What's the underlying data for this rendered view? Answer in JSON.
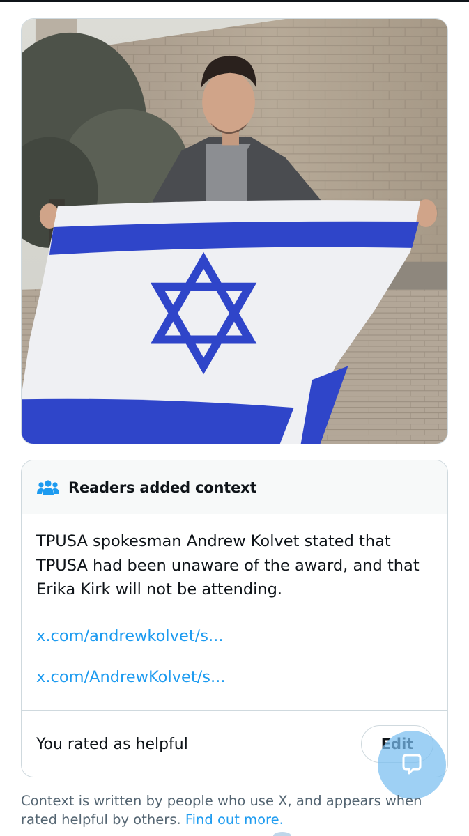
{
  "note": {
    "header_icon": "people-icon",
    "title": "Readers added context",
    "body": "TPUSA spokesman Andrew Kolvet stated that TPUSA had been unaware of the award, and that Erika Kirk will not be attending.",
    "links": [
      "x.com/andrewkolvet/s...",
      "x.com/AndrewKolvet/s..."
    ],
    "rating_text": "You rated as helpful",
    "edit_label": "Edit"
  },
  "fab_icon": "chat-bubble-icon",
  "disclaimer": {
    "text": "Context is written by people who use X, and appears when rated helpful by others.",
    "link": "Find out more."
  },
  "colors": {
    "link": "#1d9bf0",
    "flag_blue": "#2f45c9",
    "secondary_text": "#536471",
    "border": "#cfd9de"
  }
}
